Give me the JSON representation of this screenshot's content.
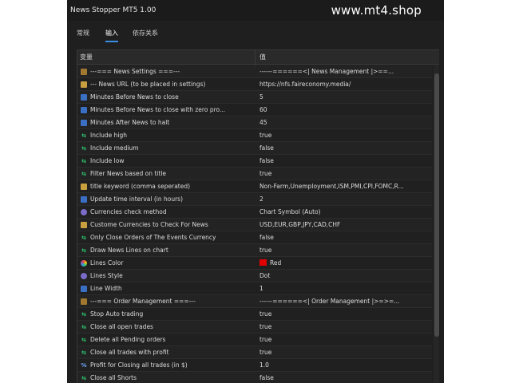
{
  "window": {
    "title": "News Stopper MT5 1.00"
  },
  "watermark": "www.mt4.shop",
  "tabs": [
    {
      "label": "常规",
      "active": false
    },
    {
      "label": "输入",
      "active": true
    },
    {
      "label": "依存关系",
      "active": false
    }
  ],
  "grid": {
    "headers": [
      "变量",
      "值"
    ],
    "rows": [
      {
        "icon": "folder",
        "label": "---=== News Settings ===---",
        "value": "------======<|  News Management  |>==..."
      },
      {
        "icon": "text",
        "label": "--- News URL (to be placed in settings)",
        "value": "https://nfs.faireconomy.media/"
      },
      {
        "icon": "num",
        "label": "Minutes Before News to close",
        "value": "5"
      },
      {
        "icon": "num",
        "label": "Minutes Before News to close with zero pro...",
        "value": "60"
      },
      {
        "icon": "num",
        "label": "Minutes After News to halt",
        "value": "45"
      },
      {
        "icon": "bool",
        "label": "Include high",
        "value": "true"
      },
      {
        "icon": "bool",
        "label": "Include medium",
        "value": "false"
      },
      {
        "icon": "bool",
        "label": "Include low",
        "value": "false"
      },
      {
        "icon": "bool",
        "label": "Filter News based on title",
        "value": "true"
      },
      {
        "icon": "text",
        "label": "title keyword (comma seperated)",
        "value": "Non-Farm,Unemployment,ISM,PMI,CPI,FOMC,R..."
      },
      {
        "icon": "num",
        "label": "Update time interval (in hours)",
        "value": "2"
      },
      {
        "icon": "enum",
        "label": "Currencies check method",
        "value": "Chart Symbol (Auto)"
      },
      {
        "icon": "text",
        "label": "Custome Currencies to Check For News",
        "value": "USD,EUR,GBP,JPY,CAD,CHF"
      },
      {
        "icon": "bool",
        "label": "Only Close Orders of The Events Currency",
        "value": "false"
      },
      {
        "icon": "bool",
        "label": "Draw News Lines on chart",
        "value": "true"
      },
      {
        "icon": "color",
        "label": "Lines Color",
        "value": "Red",
        "swatch": "#e00000"
      },
      {
        "icon": "enum",
        "label": "Lines Style",
        "value": "Dot"
      },
      {
        "icon": "num",
        "label": "Line Width",
        "value": "1"
      },
      {
        "icon": "folder",
        "label": "---=== Order Management ===---",
        "value": "------======<|  Order Management  |>=>=..."
      },
      {
        "icon": "bool",
        "label": "Stop Auto trading",
        "value": "true"
      },
      {
        "icon": "bool",
        "label": "Close all open trades",
        "value": "true"
      },
      {
        "icon": "bool",
        "label": "Delete all Pending orders",
        "value": "true"
      },
      {
        "icon": "bool",
        "label": "Close all trades with profit",
        "value": "true"
      },
      {
        "icon": "pct",
        "label": "Profit for Closing all trades (in $)",
        "value": "1.0"
      },
      {
        "icon": "bool",
        "label": "Close all Shorts",
        "value": "false"
      }
    ]
  }
}
